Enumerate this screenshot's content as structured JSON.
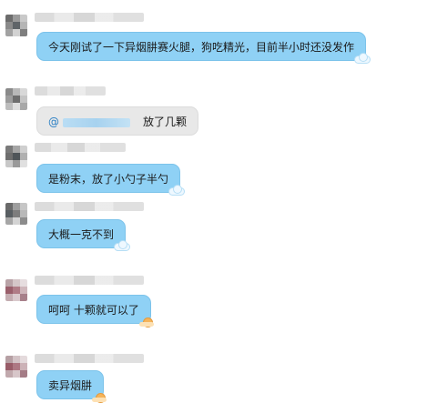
{
  "messages": [
    {
      "text": "今天刚试了一下异烟肼赛火腿，狗吃精光，目前半小时还没发作",
      "style": "blue",
      "deco": "cloud-icon"
    },
    {
      "mention": "@",
      "text": "放了几颗",
      "style": "gray",
      "deco": ""
    },
    {
      "text": "是粉末，放了小勺子半勺",
      "style": "blue",
      "deco": "cloud-icon"
    },
    {
      "text": "大概一克不到",
      "style": "blue",
      "deco": "cloud-icon"
    },
    {
      "text": "呵呵 十颗就可以了",
      "style": "blue",
      "deco": "sun-icon"
    },
    {
      "text": "卖异烟肼",
      "style": "blue",
      "deco": "sun-icon"
    }
  ],
  "colors": {
    "bubble_blue": "#8fd1f5",
    "bubble_gray": "#e8e8e8",
    "mention": "#2a7fc4"
  }
}
